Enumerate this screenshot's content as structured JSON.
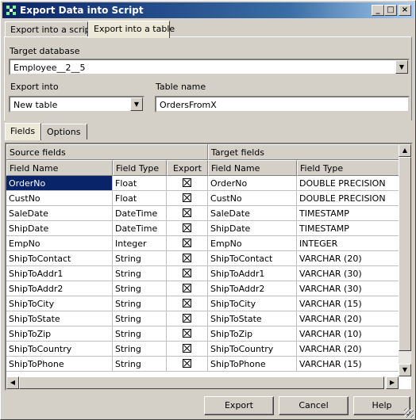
{
  "window": {
    "title": "Export Data into Script",
    "controls": {
      "minimize": "_",
      "maximize": "□",
      "close": "×"
    }
  },
  "top_tabs": [
    {
      "label": "Export into a script",
      "active": false
    },
    {
      "label": "Export into a table",
      "active": true
    }
  ],
  "target_database": {
    "label": "Target database",
    "value": "Employee__2__5"
  },
  "export_into": {
    "label": "Export into",
    "value": "New table"
  },
  "table_name": {
    "label": "Table name",
    "value": "OrdersFromX"
  },
  "inner_tabs": [
    {
      "label": "Fields",
      "active": true
    },
    {
      "label": "Options",
      "active": false
    }
  ],
  "grid": {
    "group_headers": {
      "source": "Source fields",
      "target": "Target fields"
    },
    "columns": [
      "Field Name",
      "Field Type",
      "Export",
      "Field Name",
      "Field Type"
    ],
    "rows": [
      {
        "src_name": "OrderNo",
        "src_type": "Float",
        "export": true,
        "tgt_name": "OrderNo",
        "tgt_type": "DOUBLE PRECISION"
      },
      {
        "src_name": "CustNo",
        "src_type": "Float",
        "export": true,
        "tgt_name": "CustNo",
        "tgt_type": "DOUBLE PRECISION"
      },
      {
        "src_name": "SaleDate",
        "src_type": "DateTime",
        "export": true,
        "tgt_name": "SaleDate",
        "tgt_type": "TIMESTAMP"
      },
      {
        "src_name": "ShipDate",
        "src_type": "DateTime",
        "export": true,
        "tgt_name": "ShipDate",
        "tgt_type": "TIMESTAMP"
      },
      {
        "src_name": "EmpNo",
        "src_type": "Integer",
        "export": true,
        "tgt_name": "EmpNo",
        "tgt_type": "INTEGER"
      },
      {
        "src_name": "ShipToContact",
        "src_type": "String",
        "export": true,
        "tgt_name": "ShipToContact",
        "tgt_type": "VARCHAR  (20)"
      },
      {
        "src_name": "ShipToAddr1",
        "src_type": "String",
        "export": true,
        "tgt_name": "ShipToAddr1",
        "tgt_type": "VARCHAR  (30)"
      },
      {
        "src_name": "ShipToAddr2",
        "src_type": "String",
        "export": true,
        "tgt_name": "ShipToAddr2",
        "tgt_type": "VARCHAR  (30)"
      },
      {
        "src_name": "ShipToCity",
        "src_type": "String",
        "export": true,
        "tgt_name": "ShipToCity",
        "tgt_type": "VARCHAR  (15)"
      },
      {
        "src_name": "ShipToState",
        "src_type": "String",
        "export": true,
        "tgt_name": "ShipToState",
        "tgt_type": "VARCHAR  (20)"
      },
      {
        "src_name": "ShipToZip",
        "src_type": "String",
        "export": true,
        "tgt_name": "ShipToZip",
        "tgt_type": "VARCHAR  (10)"
      },
      {
        "src_name": "ShipToCountry",
        "src_type": "String",
        "export": true,
        "tgt_name": "ShipToCountry",
        "tgt_type": "VARCHAR  (20)"
      },
      {
        "src_name": "ShipToPhone",
        "src_type": "String",
        "export": true,
        "tgt_name": "ShipToPhone",
        "tgt_type": "VARCHAR  (15)"
      }
    ]
  },
  "buttons": {
    "export": "Export",
    "cancel": "Cancel",
    "help": "Help"
  }
}
